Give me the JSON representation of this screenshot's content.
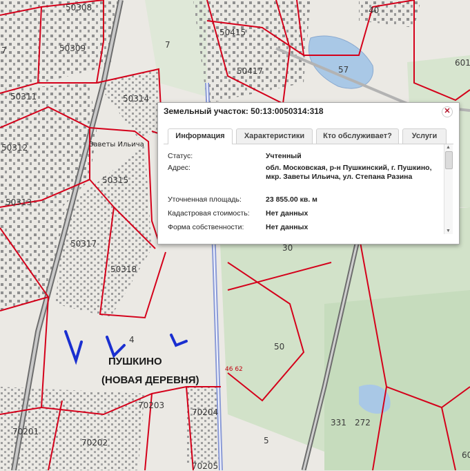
{
  "map": {
    "plot_labels": [
      {
        "id": "50308",
        "text": "50308"
      },
      {
        "id": "50309",
        "text": "50309"
      },
      {
        "id": "50311",
        "text": "50311"
      },
      {
        "id": "50312",
        "text": "50312"
      },
      {
        "id": "50313",
        "text": "50313"
      },
      {
        "id": "50314",
        "text": "50314"
      },
      {
        "id": "50315",
        "text": "50315"
      },
      {
        "id": "50317",
        "text": "50317"
      },
      {
        "id": "50318",
        "text": "50318"
      },
      {
        "id": "50415",
        "text": "50415"
      },
      {
        "id": "50417",
        "text": "50417"
      },
      {
        "id": "70201",
        "text": "70201"
      },
      {
        "id": "70202",
        "text": "70202"
      },
      {
        "id": "70203",
        "text": "70203"
      },
      {
        "id": "70204",
        "text": "70204"
      },
      {
        "id": "70205",
        "text": "70205"
      },
      {
        "id": "n7a",
        "text": "7"
      },
      {
        "id": "n7b",
        "text": "7"
      },
      {
        "id": "n40",
        "text": "40"
      },
      {
        "id": "n57",
        "text": "57"
      },
      {
        "id": "n601",
        "text": "601"
      },
      {
        "id": "n30",
        "text": "30"
      },
      {
        "id": "n50",
        "text": "50"
      },
      {
        "id": "n4662",
        "text": "46 62"
      },
      {
        "id": "n4",
        "text": "4"
      },
      {
        "id": "n331",
        "text": "331"
      },
      {
        "id": "n272",
        "text": "272"
      },
      {
        "id": "n5",
        "text": "5"
      },
      {
        "id": "n60",
        "text": "60"
      }
    ],
    "district_label": "Заветы Ильича",
    "area_title_line1": "ПУШКИНО",
    "area_title_line2": "(НОВАЯ ДЕРЕВНЯ)",
    "colors": {
      "cadastral_border": "#d4001a",
      "highway": "#8a9ad6",
      "forest": "#cfe0c6",
      "annotation_blue": "#1a2fd0"
    }
  },
  "popup": {
    "title": "Земельный участок: 50:13:0050314:318",
    "close_icon": "close-icon",
    "tabs": [
      {
        "label": "Информация",
        "active": true
      },
      {
        "label": "Характеристики",
        "active": false
      },
      {
        "label": "Кто обслуживает?",
        "active": false
      },
      {
        "label": "Услуги",
        "active": false
      }
    ],
    "fields": [
      {
        "key": "Статус:",
        "value": "Учтенный"
      },
      {
        "key": "Адрес:",
        "value": "обл. Московская, р-н Пушкинский, г. Пушкино, мкр. Заветы Ильича, ул. Степана Разина"
      },
      {
        "key": "Уточненная площадь:",
        "value": "23 855.00 кв. м"
      },
      {
        "key": "Кадастровая стоимость:",
        "value": "Нет данных"
      },
      {
        "key": "Форма собственности:",
        "value": "Нет данных"
      }
    ]
  }
}
